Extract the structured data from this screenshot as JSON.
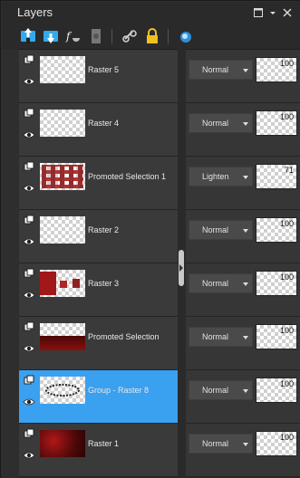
{
  "panel": {
    "title": "Layers"
  },
  "layers": [
    {
      "name": "Raster 5",
      "blend": "Normal",
      "opacity": "100",
      "opacity_frac": 1.0,
      "thumb": "empty",
      "selected": false
    },
    {
      "name": "Raster 4",
      "blend": "Normal",
      "opacity": "100",
      "opacity_frac": 1.0,
      "thumb": "empty",
      "selected": false
    },
    {
      "name": "Promoted Selection 1",
      "blend": "Lighten",
      "opacity": "71",
      "opacity_frac": 0.71,
      "thumb": "red-blocks",
      "selected": false
    },
    {
      "name": "Raster 2",
      "blend": "Normal",
      "opacity": "100",
      "opacity_frac": 1.0,
      "thumb": "empty",
      "selected": false
    },
    {
      "name": "Raster 3",
      "blend": "Normal",
      "opacity": "100",
      "opacity_frac": 1.0,
      "thumb": "red-patches",
      "selected": false
    },
    {
      "name": "Promoted Selection",
      "blend": "Normal",
      "opacity": "100",
      "opacity_frac": 1.0,
      "thumb": "red-bottom",
      "selected": false
    },
    {
      "name": "Group - Raster 8",
      "blend": "Normal",
      "opacity": "100",
      "opacity_frac": 1.0,
      "thumb": "ring",
      "selected": true
    },
    {
      "name": "Raster 1",
      "blend": "Normal",
      "opacity": "100",
      "opacity_frac": 1.0,
      "thumb": "red-full",
      "selected": false
    }
  ],
  "colors": {
    "selection": "#3aa0f0",
    "row": "#3a3a3a",
    "panel": "#2b2b2b"
  }
}
